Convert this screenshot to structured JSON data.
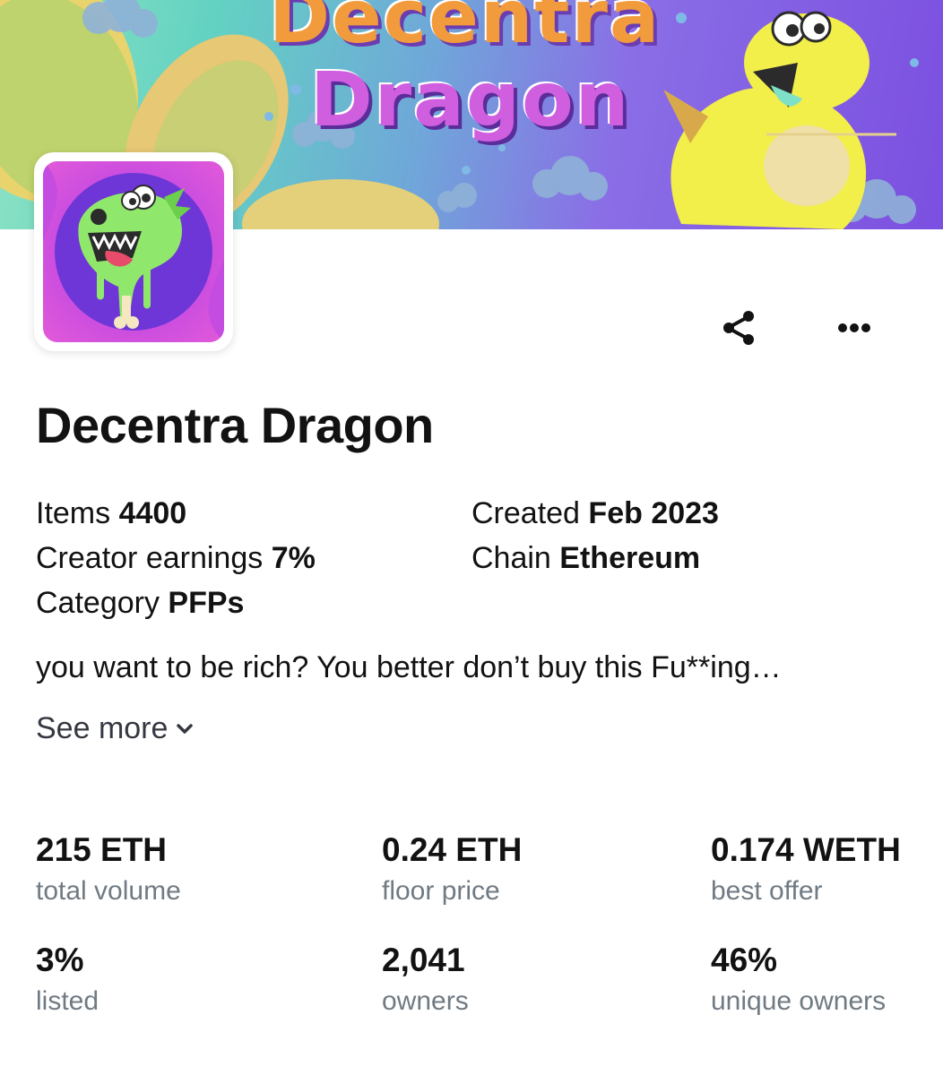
{
  "collection": {
    "banner_text_line1": "Decentra",
    "banner_text_line2": "Dragon",
    "name": "Decentra Dragon",
    "description": "you want to be rich? You better don’t buy this Fu**ing…",
    "see_more_label": "See more"
  },
  "details": {
    "items_label": "Items",
    "items_value": "4400",
    "creator_earnings_label": "Creator earnings",
    "creator_earnings_value": "7%",
    "category_label": "Category",
    "category_value": "PFPs",
    "created_label": "Created",
    "created_value": "Feb 2023",
    "chain_label": "Chain",
    "chain_value": "Ethereum"
  },
  "stats": [
    {
      "value": "215 ETH",
      "label": "total volume"
    },
    {
      "value": "0.24 ETH",
      "label": "floor price"
    },
    {
      "value": "0.174 WETH",
      "label": "best offer"
    },
    {
      "value": "3%",
      "label": "listed"
    },
    {
      "value": "2,041",
      "label": "owners"
    },
    {
      "value": "46%",
      "label": "unique owners"
    }
  ],
  "icons": {
    "share": "share-icon",
    "more": "more-icon",
    "see_more": "chevron-down-icon"
  },
  "colors": {
    "text_primary": "#121212",
    "text_secondary": "#707a83",
    "banner_purple": "#7b4fe0",
    "banner_green": "#63d2c2"
  }
}
